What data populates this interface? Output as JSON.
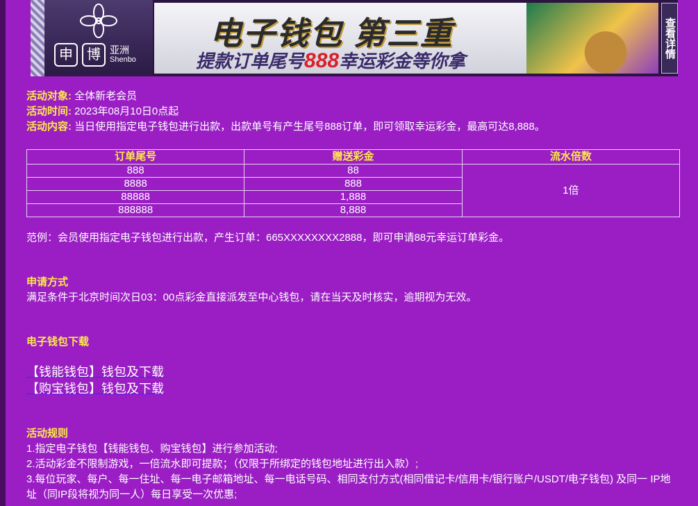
{
  "banner": {
    "logo_char1": "申",
    "logo_char2": "博",
    "logo_cn": "亚洲",
    "logo_en": "Shenbo",
    "title": "电子钱包 第三重",
    "subtitle_pre": "提款订单尾号",
    "subtitle_num": "888",
    "subtitle_post": "幸运彩金等你拿",
    "detail_button": "查看详情"
  },
  "intro": {
    "target_label": "活动对象:",
    "target_value": "全体新老会员",
    "time_label": "活动时间:",
    "time_value": "2023年08月10日0点起",
    "content_label": "活动内容:",
    "content_value": "当日使用指定电子钱包进行出款，出款单号有产生尾号888订单，即可领取幸运彩金，最高可达8,888。"
  },
  "table": {
    "headers": [
      "订单尾号",
      "赠送彩金",
      "流水倍数"
    ],
    "rows": [
      [
        "888",
        "88"
      ],
      [
        "8888",
        "888"
      ],
      [
        "88888",
        "1,888"
      ],
      [
        "888888",
        "8,888"
      ]
    ],
    "turnover": "1倍"
  },
  "example": "范例：会员使用指定电子钱包进行出款，产生订单：665XXXXXXXX2888，即可申请88元幸运订单彩金。",
  "apply": {
    "title": "申请方式",
    "text": "满足条件于北京时间次日03：00点彩金直接派发至中心钱包，请在当天及时核实，逾期视为无效。"
  },
  "download": {
    "title": "电子钱包下载",
    "link1": "【钱能钱包】钱包及下载",
    "link2": "【购宝钱包】钱包及下载"
  },
  "rules": {
    "title": "活动规则",
    "r1": "1.指定电子钱包【钱能钱包、购宝钱包】进行参加活动;",
    "r2": "2.活动彩金不限制游戏，一倍流水即可提款；（仅限于所绑定的钱包地址进行出入款）;",
    "r3": "3.每位玩家、每户、每一住址、每一电子邮箱地址、每一电话号码、相同支付方式(相同借记卡/信用卡/银行账户/USDT/电子钱包) 及同一 IP地址（同IP段将视为同一人）每日享受一次优惠;"
  }
}
